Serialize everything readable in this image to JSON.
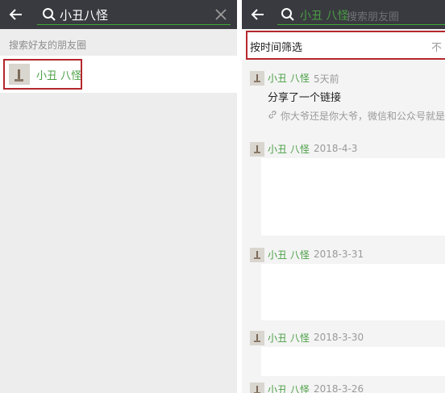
{
  "left_screen": {
    "search_query": "小丑八怪",
    "section_hint": "搜索好友的朋友圈",
    "result_name": "小丑 八怪"
  },
  "right_screen": {
    "search_chip": "小丑 八怪",
    "search_placeholder": "搜索朋友圈",
    "filter_label": "按时间筛选",
    "filter_right": "不",
    "posts": [
      {
        "name": "小丑 八怪",
        "date": "5天前",
        "text": "分享了一个链接",
        "link_text": "你大爷还是你大爷，微信和公众号就是互"
      },
      {
        "name": "小丑 八怪",
        "date": "2018-4-3"
      },
      {
        "name": "小丑 八怪",
        "date": "2018-3-31"
      },
      {
        "name": "小丑 八怪",
        "date": "2018-3-30"
      },
      {
        "name": "小丑 八怪",
        "date": "2018-3-26"
      }
    ]
  },
  "colors": {
    "topbar": "#393a3f",
    "accent_green": "#4a9f45",
    "highlight_red": "#b5272d"
  },
  "icons": [
    "back-arrow-icon",
    "search-icon",
    "clear-icon",
    "link-icon"
  ]
}
